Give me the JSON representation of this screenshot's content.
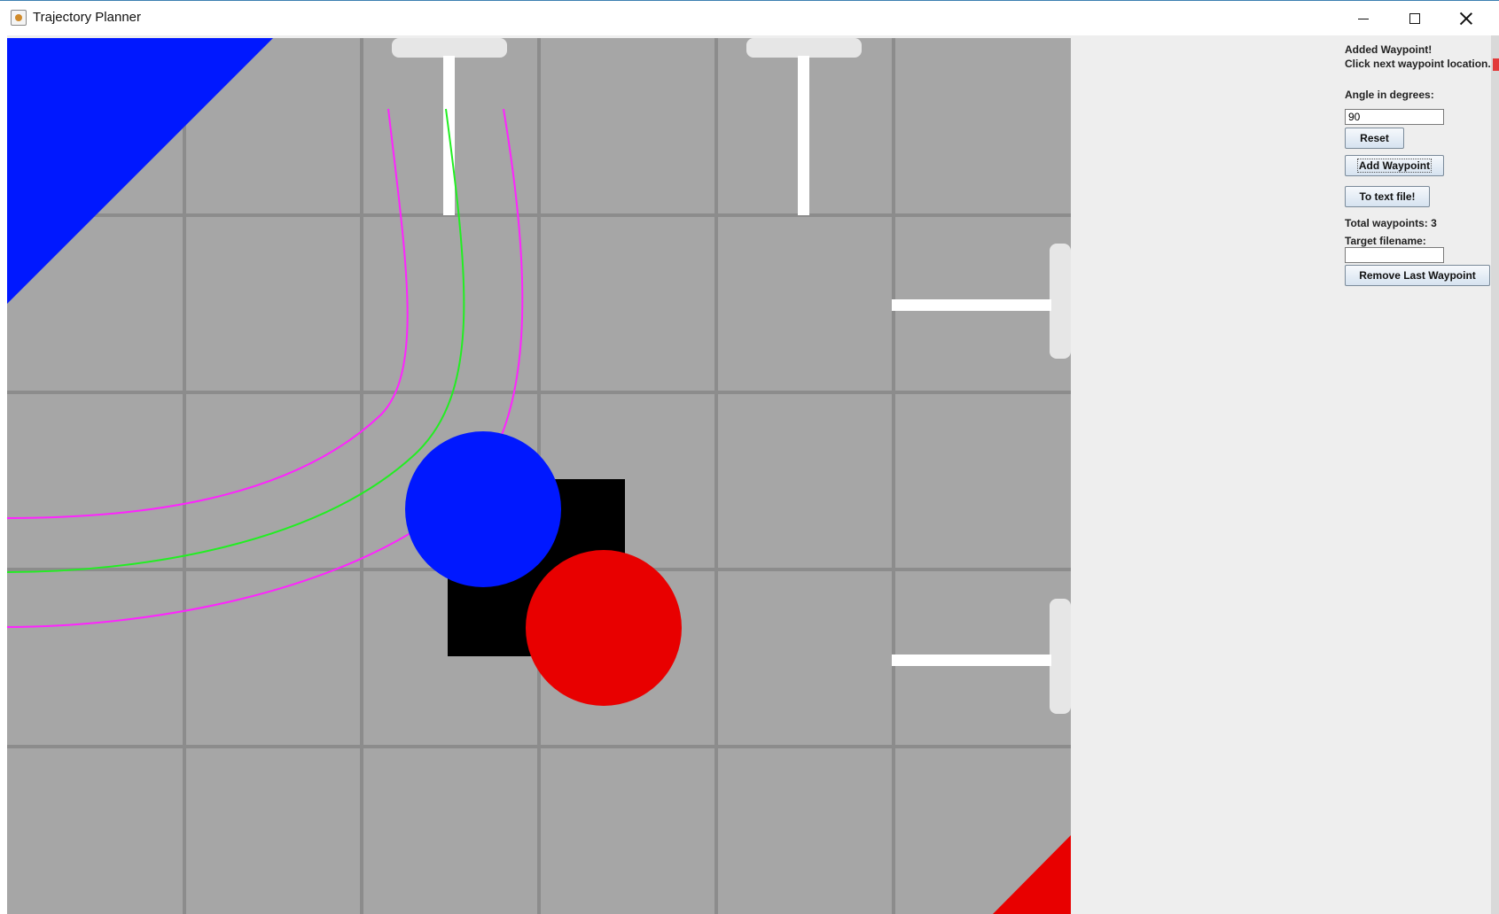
{
  "window": {
    "title": "Trajectory Planner",
    "icon": "java-cup-icon",
    "controls": {
      "minimize": "minimize-icon",
      "maximize": "maximize-icon",
      "close": "close-icon"
    }
  },
  "panel": {
    "status_line1": "Added Waypoint!",
    "status_line2": "Click next waypoint location.",
    "angle_label": "Angle in degrees:",
    "angle_value": "90",
    "reset_label": "Reset",
    "add_waypoint_label": "Add Waypoint",
    "to_text_file_label": "To text file!",
    "total_waypoints": "Total waypoints: 3",
    "target_filename_label": "Target filename:",
    "target_filename_value": "",
    "remove_last_label": "Remove Last Waypoint"
  },
  "field": {
    "colors": {
      "tile": "#a6a6a6",
      "grid_line": "#8c8c8c",
      "blue_zone": "#0018ff",
      "red_zone": "#e80000",
      "robot_body": "#000000",
      "blue_robot": "#0018ff",
      "red_robot": "#e80000",
      "path_center": "#22ee22",
      "path_edge": "#ff22ff",
      "barrier": "#ffffff",
      "dock": "#e6e6e6"
    }
  }
}
